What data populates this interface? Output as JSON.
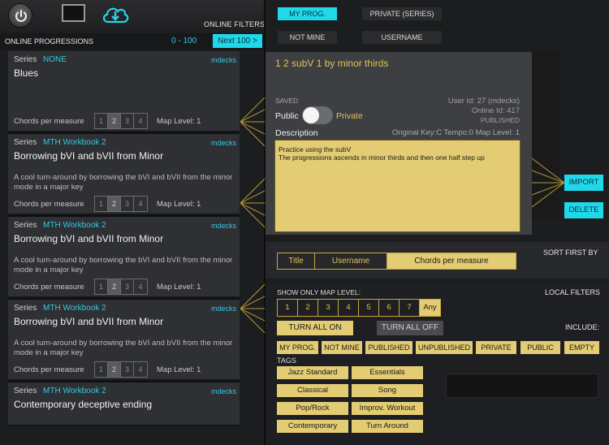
{
  "toolbar": {
    "online_filters_label": "ONLINE FILTERS"
  },
  "list_header": {
    "title": "ONLINE PROGRESSIONS",
    "range": "0 - 100",
    "next_label": "Next 100 >"
  },
  "progressions": [
    {
      "series_label": "Series",
      "series": "NONE",
      "author": "mdecks",
      "title": "Blues",
      "description": "",
      "cpm_label": "Chords per measure",
      "cpm_options": [
        "1",
        "2",
        "3",
        "4"
      ],
      "cpm_selected": "2",
      "map_level": "Map Level: 1"
    },
    {
      "series_label": "Series",
      "series": "MTH Workbook 2",
      "author": "mdecks",
      "title": "Borrowing bVI and bVII from Minor",
      "description": "A cool turn-around by borrowing the bVI and bVII from the minor mode in a major key",
      "cpm_label": "Chords per measure",
      "cpm_options": [
        "1",
        "2",
        "3",
        "4"
      ],
      "cpm_selected": "2",
      "map_level": "Map Level: 1"
    },
    {
      "series_label": "Series",
      "series": "MTH Workbook 2",
      "author": "mdecks",
      "title": "Borrowing bVI and bVII from Minor",
      "description": "A cool turn-around by borrowing the bVI and bVII from the minor mode in a major key",
      "cpm_label": "Chords per measure",
      "cpm_options": [
        "1",
        "2",
        "3",
        "4"
      ],
      "cpm_selected": "2",
      "map_level": "Map Level: 1"
    },
    {
      "series_label": "Series",
      "series": "MTH Workbook 2",
      "author": "mdecks",
      "title": "Borrowing bVI and bVII from Minor",
      "description": "A cool turn-around by borrowing the bVI and bVII from the minor mode in a major key",
      "cpm_label": "Chords per measure",
      "cpm_options": [
        "1",
        "2",
        "3",
        "4"
      ],
      "cpm_selected": "2",
      "map_level": "Map Level: 1"
    },
    {
      "series_label": "Series",
      "series": "MTH Workbook 2",
      "author": "mdecks",
      "title": "Contemporary deceptive ending",
      "description": "",
      "cpm_label": "",
      "cpm_options": [],
      "cpm_selected": "",
      "map_level": ""
    }
  ],
  "tabs": {
    "my_prog": "MY PROG.",
    "private_series": "PRIVATE (SERIES)",
    "not_mine": "NOT MINE",
    "username": "USERNAME"
  },
  "detail": {
    "title": "1 2 subV 1 by minor thirds",
    "saved_label": "SAVED",
    "public_label": "Public",
    "private_label": "Private",
    "user_id": "User Id: 27 (mdecks)",
    "online_id": "Online Id: 417",
    "published": "PUBLISHED",
    "description_label": "Description",
    "original_key": "Original Key:C Tempo:0 Map Level: 1",
    "description_line1": "Practice using the subV",
    "description_line2": "The progressions ascends in minor thirds and then one half step up"
  },
  "actions": {
    "import": "IMPORT",
    "delete": "DELETE"
  },
  "sort": {
    "label": "SORT FIRST BY",
    "title": "Title",
    "username": "Username",
    "cpm": "Chords per measure"
  },
  "local_filters": {
    "show_map_label": "SHOW ONLY MAP LEVEL:",
    "label": "LOCAL FILTERS",
    "levels": [
      "1",
      "2",
      "3",
      "4",
      "5",
      "6",
      "7",
      "Any"
    ],
    "turn_all_on": "TURN ALL ON",
    "turn_all_off": "TURN ALL OFF",
    "include_label": "INCLUDE:",
    "include": [
      "MY PROG.",
      "NOT MINE",
      "PUBLISHED",
      "UNPUBLISHED",
      "PRIVATE",
      "PUBLIC",
      "EMPTY"
    ],
    "tags_label": "TAGS",
    "tags": [
      "Jazz Standard",
      "Essentials",
      "Classical",
      "Song",
      "Pop/Rock",
      "Improv. Workout",
      "Contemporary",
      "Turn Around"
    ]
  },
  "colors": {
    "accent_cyan": "#1fd8ec",
    "accent_gold": "#e3cc73",
    "panel": "#3d3f43"
  }
}
